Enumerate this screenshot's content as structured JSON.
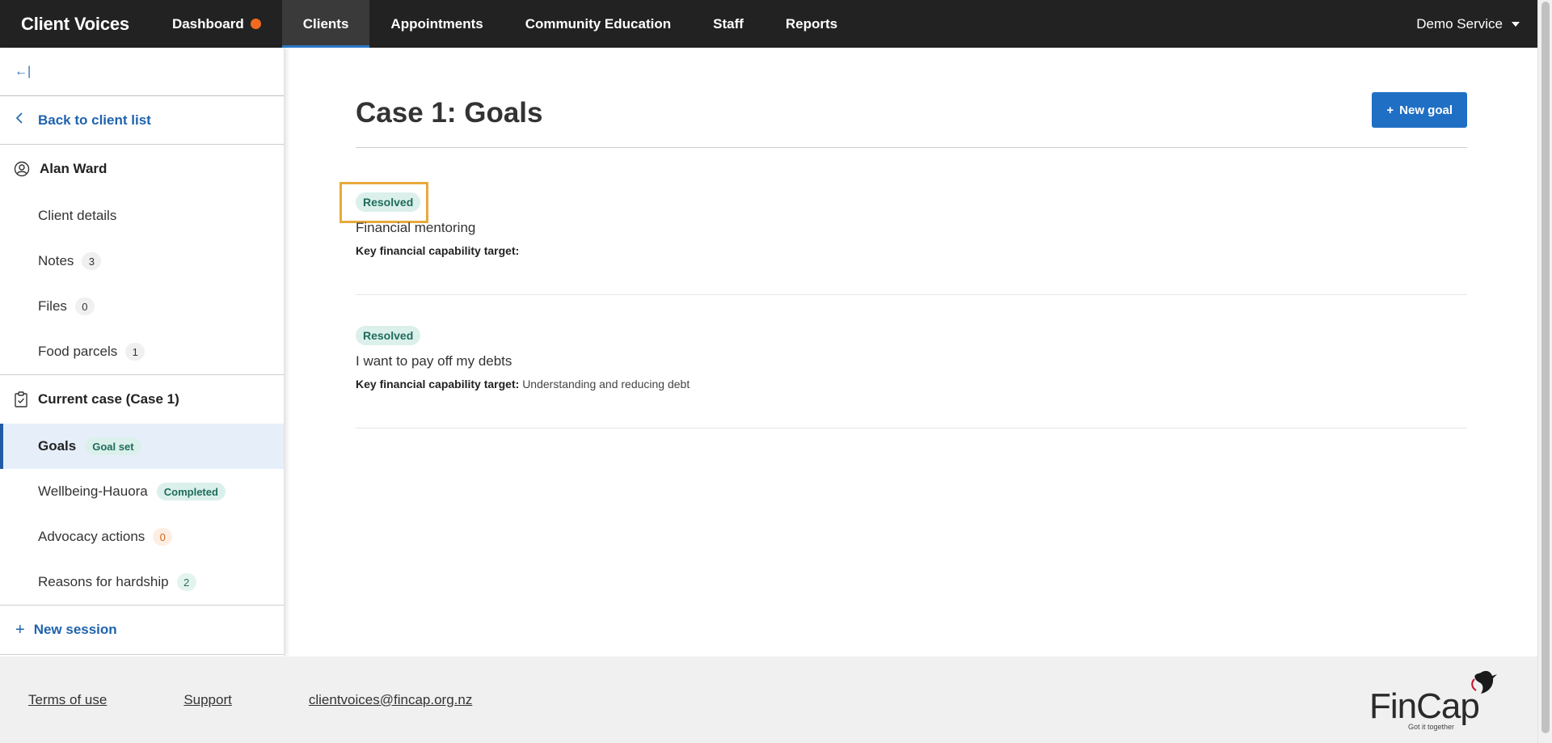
{
  "nav": {
    "brand": "Client Voices",
    "items": [
      {
        "label": "Dashboard"
      },
      {
        "label": "Clients"
      },
      {
        "label": "Appointments"
      },
      {
        "label": "Community Education"
      },
      {
        "label": "Staff"
      },
      {
        "label": "Reports"
      }
    ],
    "account": "Demo Service"
  },
  "sidebar": {
    "collapse_icon": "←|",
    "back_label": "Back to client list",
    "client_name": "Alan Ward",
    "client_items": [
      {
        "label": "Client details",
        "count": null
      },
      {
        "label": "Notes",
        "count": "3"
      },
      {
        "label": "Files",
        "count": "0"
      },
      {
        "label": "Food parcels",
        "count": "1"
      }
    ],
    "case_title": "Current case (Case 1)",
    "case_items": [
      {
        "label": "Goals",
        "badge": "Goal set"
      },
      {
        "label": "Wellbeing-Hauora",
        "badge": "Completed"
      },
      {
        "label": "Advocacy actions",
        "count": "0"
      },
      {
        "label": "Reasons for hardship",
        "count": "2"
      }
    ],
    "new_session": "New session"
  },
  "main": {
    "title": "Case 1: Goals",
    "new_goal_label": "New goal",
    "goals": [
      {
        "status": "Resolved",
        "title": "Financial mentoring",
        "target_label": "Key financial capability target:",
        "target_value": ""
      },
      {
        "status": "Resolved",
        "title": "I want to pay off my debts",
        "target_label": "Key financial capability target:",
        "target_value": "Understanding and reducing debt"
      }
    ]
  },
  "footer": {
    "links": [
      "Terms of use",
      "Support",
      "clientvoices@fincap.org.nz"
    ],
    "logo_text": "FinCap",
    "logo_tagline": "Got it together"
  },
  "colors": {
    "nav_bg": "#222222",
    "accent_blue": "#1f6fc5",
    "status_green": "#dcf0eb",
    "highlight_orange": "#e8a93c",
    "notification_orange": "#f06b1f"
  }
}
